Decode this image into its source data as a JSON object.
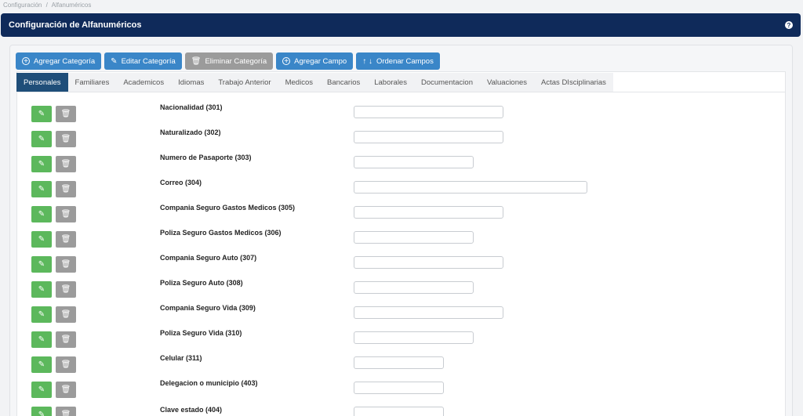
{
  "breadcrumb": [
    "Configuración",
    "/",
    "Alfanuméricos"
  ],
  "header": {
    "title": "Configuración de Alfanuméricos",
    "help_label": "?"
  },
  "toolbar": {
    "add_category": "Agregar Categoría",
    "edit_category": "Editar Categoría",
    "delete_category": "Eliminar Categoría",
    "add_field": "Agregar Campo",
    "sort_fields": "Ordenar Campos"
  },
  "tabs": [
    "Personales",
    "Familiares",
    "Academicos",
    "Idiomas",
    "Trabajo Anterior",
    "Medicos",
    "Bancarios",
    "Laborales",
    "Documentacion",
    "Valuaciones",
    "Actas DIsciplinarias"
  ],
  "active_tab": "Personales",
  "fields": [
    {
      "label": "Nacionalidad (301)",
      "value": ""
    },
    {
      "label": "Naturalizado (302)",
      "value": ""
    },
    {
      "label": "Numero de Pasaporte (303)",
      "value": ""
    },
    {
      "label": "Correo (304)",
      "value": ""
    },
    {
      "label": "Compania Seguro Gastos Medicos (305)",
      "value": ""
    },
    {
      "label": "Poliza Seguro Gastos Medicos (306)",
      "value": ""
    },
    {
      "label": "Compania Seguro Auto (307)",
      "value": ""
    },
    {
      "label": "Poliza Seguro Auto (308)",
      "value": ""
    },
    {
      "label": "Compania Seguro Vida (309)",
      "value": ""
    },
    {
      "label": "Poliza Seguro Vida (310)",
      "value": ""
    },
    {
      "label": "Celular (311)",
      "value": ""
    },
    {
      "label": "Delegacion o municipio (403)",
      "value": ""
    },
    {
      "label": "Clave estado (404)",
      "value": ""
    }
  ],
  "icons": {
    "edit": "pencil-icon",
    "delete": "trash-icon",
    "add": "circle-plus-icon",
    "sort": "arrows-up-down-icon",
    "help": "help-icon"
  },
  "colors": {
    "header_bg": "#0f2a5a",
    "primary_button": "#3a86c8",
    "disabled_button": "#9b9b9b",
    "edit_button": "#5cb85c",
    "active_tab": "#1f4e79"
  }
}
